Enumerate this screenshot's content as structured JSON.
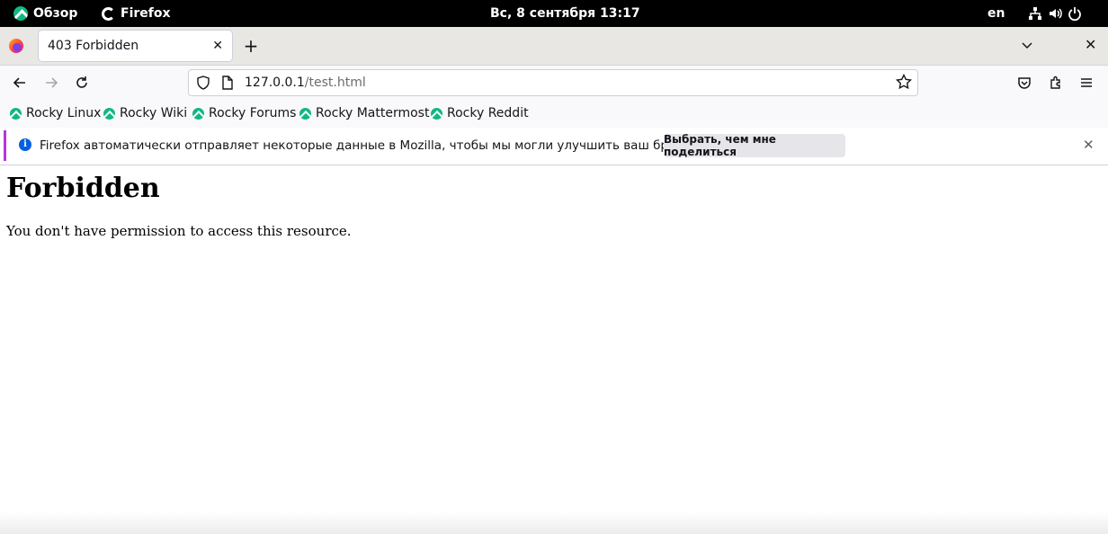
{
  "system": {
    "activities_label": "Обзор",
    "app_label": "Firefox",
    "clock": "Вс, 8 сентября  13:17",
    "keyboard_layout": "en"
  },
  "browser": {
    "tab": {
      "title": "403 Forbidden",
      "close": "✕"
    },
    "new_tab": "+",
    "list_tabs": "⌵",
    "window_close": "✕",
    "url": {
      "host": "127.0.0.1",
      "path": "/test.html"
    },
    "bookmarks": [
      {
        "label": "Rocky Linux"
      },
      {
        "label": "Rocky Wiki"
      },
      {
        "label": "Rocky Forums"
      },
      {
        "label": "Rocky Mattermost"
      },
      {
        "label": "Rocky Reddit"
      }
    ],
    "notification": {
      "text": "Firefox автоматически отправляет некоторые данные в Mozilla, чтобы мы могли улучшить ваш браузер.",
      "button": "Выбрать, чем мне поделиться",
      "close": "✕"
    }
  },
  "page": {
    "heading": "Forbidden",
    "message": "You don't have permission to access this resource."
  },
  "colors": {
    "topbar": "#000000",
    "accent_notification": "#b833e1",
    "rocky_green": "#10b981",
    "info_blue": "#0060df"
  }
}
